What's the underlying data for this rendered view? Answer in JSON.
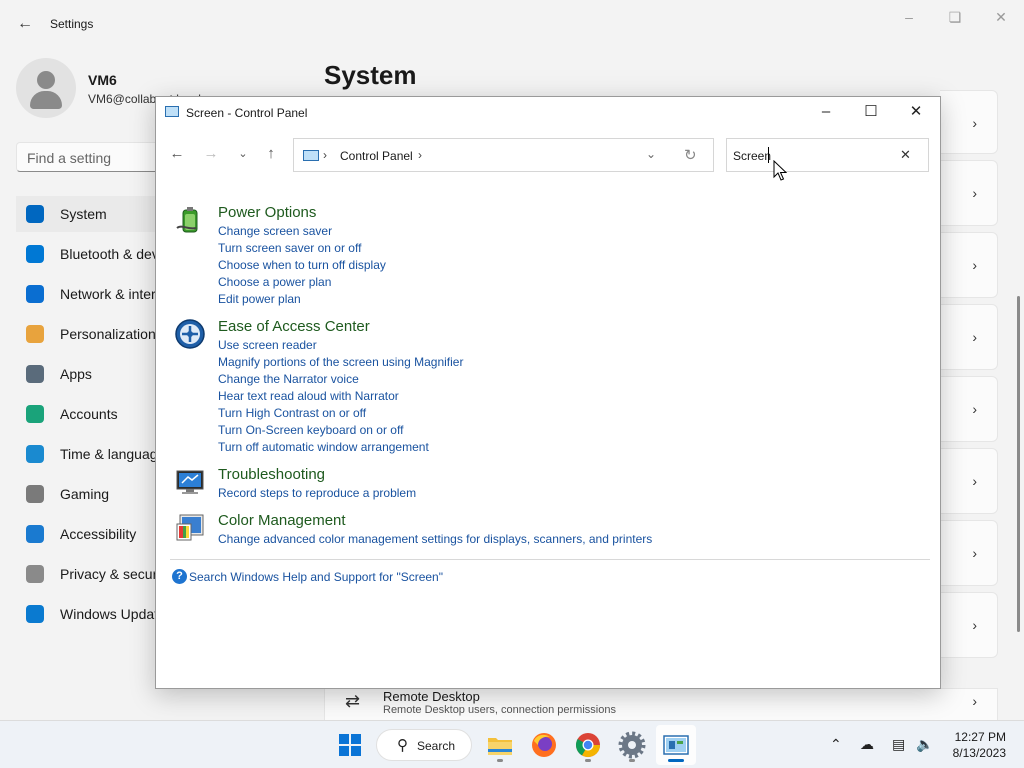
{
  "settings": {
    "title": "Settings",
    "user": {
      "name": "VM6",
      "email": "VM6@collabnet.local"
    },
    "search_placeholder": "Find a setting",
    "page_title": "System",
    "nav": [
      {
        "label": "System",
        "icon": "system-monitor-icon",
        "color": "#0067c0"
      },
      {
        "label": "Bluetooth & devices",
        "icon": "bluetooth-icon",
        "color": "#0078d4"
      },
      {
        "label": "Network & internet",
        "icon": "wifi-icon",
        "color": "#0a6ed1"
      },
      {
        "label": "Personalization",
        "icon": "brush-icon",
        "color": "#e8a33d"
      },
      {
        "label": "Apps",
        "icon": "apps-icon",
        "color": "#5a6b7b"
      },
      {
        "label": "Accounts",
        "icon": "accounts-icon",
        "color": "#1aa37a"
      },
      {
        "label": "Time & language",
        "icon": "globe-clock-icon",
        "color": "#1a8ad0"
      },
      {
        "label": "Gaming",
        "icon": "controller-icon",
        "color": "#7a7a7a"
      },
      {
        "label": "Accessibility",
        "icon": "accessibility-icon",
        "color": "#1a7ad0"
      },
      {
        "label": "Privacy & security",
        "icon": "shield-icon",
        "color": "#8a8a8a"
      },
      {
        "label": "Windows Update",
        "icon": "update-icon",
        "color": "#0a7ad0"
      }
    ],
    "remote_desktop": {
      "title": "Remote Desktop",
      "subtitle": "Remote Desktop users, connection permissions"
    }
  },
  "control_panel": {
    "title": "Screen - Control Panel",
    "address": {
      "crumb": "Control Panel"
    },
    "search_value": "Screen",
    "groups": [
      {
        "title": "Power Options",
        "icon": "power-options-icon",
        "links": [
          "Change screen saver",
          "Turn screen saver on or off",
          "Choose when to turn off display",
          "Choose a power plan",
          "Edit power plan"
        ]
      },
      {
        "title": "Ease of Access Center",
        "icon": "ease-of-access-icon",
        "links": [
          "Use screen reader",
          "Magnify portions of the screen using Magnifier",
          "Change the Narrator voice",
          "Hear text read aloud with Narrator",
          "Turn High Contrast on or off",
          "Turn On-Screen keyboard on or off",
          "Turn off automatic window arrangement"
        ]
      },
      {
        "title": "Troubleshooting",
        "icon": "troubleshooting-icon",
        "links": [
          "Record steps to reproduce a problem"
        ]
      },
      {
        "title": "Color Management",
        "icon": "color-management-icon",
        "links": [
          "Change advanced color management settings for displays, scanners, and printers"
        ]
      }
    ],
    "help_link": "Search Windows Help and Support for \"Screen\""
  },
  "taskbar": {
    "search_label": "Search",
    "time": "12:27 PM",
    "date": "8/13/2023"
  }
}
